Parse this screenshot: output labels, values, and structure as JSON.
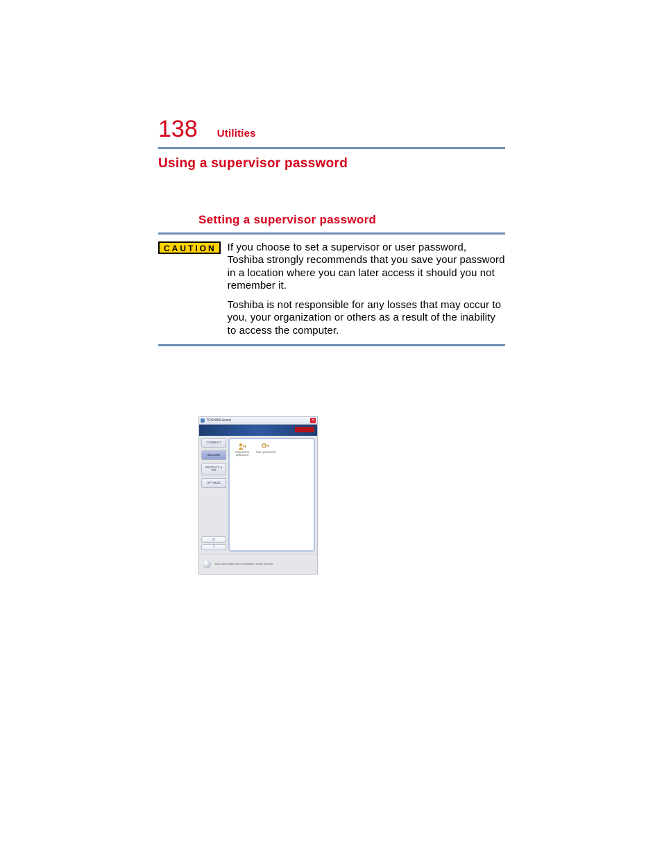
{
  "page": {
    "number": "138",
    "chapter": "Utilities"
  },
  "section": {
    "title": "Using a supervisor password",
    "subtitle": "Setting a supervisor password"
  },
  "caution": {
    "badge": "CAUTION",
    "p1": "If you choose to set a supervisor or user password, Toshiba strongly recommends that you save your password in a location where you can later access it should you not remember it.",
    "p2": "Toshiba is not responsible for any losses that may occur to you, your organization or others as a result of the inability to access the computer."
  },
  "screenshot": {
    "app_title": "TOSHIBA Assist",
    "tabs": {
      "connect": "CONNECT",
      "secure": "SECURE",
      "protectfix": "PROTECT & FIX",
      "optimize": "OPTIMIZE"
    },
    "items": {
      "supervisor": "Supervisor password",
      "user": "User password"
    },
    "status": "You can make your computer more secure",
    "bottom_refresh": "⟳",
    "bottom_help": "?"
  }
}
